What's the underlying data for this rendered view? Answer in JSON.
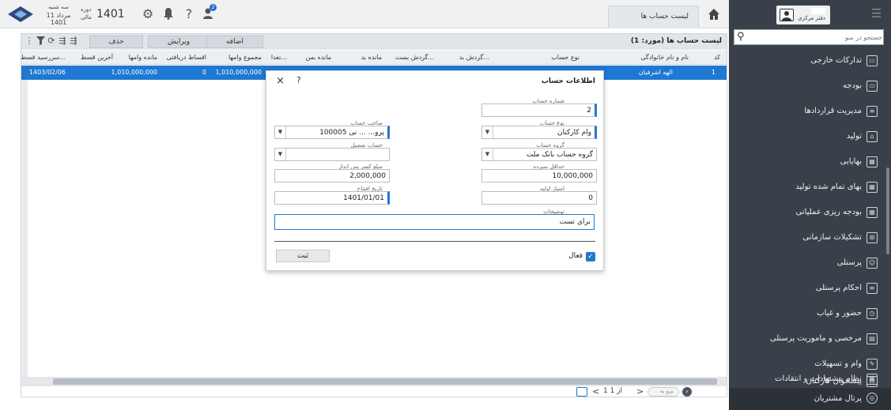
{
  "topbar": {
    "date_line1": "سه شنبه",
    "date_line2": "11 مرداد 1401",
    "period_label": "دوره مالی",
    "period_year": "1401",
    "notification_count": "2",
    "tab_label": "لیست حساب ها"
  },
  "sidebar": {
    "office_label": "دفتر مرکزی",
    "search_placeholder": "جستجو در منو",
    "items": [
      {
        "label": "تدارکات خارجی",
        "icon": "cart-icon"
      },
      {
        "label": "بودجه",
        "icon": "wallet-icon"
      },
      {
        "label": "مدیریت قراردادها",
        "icon": "contract-icon"
      },
      {
        "label": "تولید",
        "icon": "factory-icon"
      },
      {
        "label": "بهایابی",
        "icon": "calculator-icon"
      },
      {
        "label": "بهای تمام شده تولید",
        "icon": "calculator-icon"
      },
      {
        "label": "بودجه ریزی عملیاتی",
        "icon": "calculator-icon"
      },
      {
        "label": "تشکیلات سازمانی",
        "icon": "org-chart-icon"
      },
      {
        "label": "پرسنلی",
        "icon": "person-icon"
      },
      {
        "label": "احکام پرسنلی",
        "icon": "document-icon"
      },
      {
        "label": "حضور و غیاب",
        "icon": "clock-icon"
      },
      {
        "label": "مرخصی و ماموریت پرسنلی",
        "icon": "calendar-icon"
      },
      {
        "label": "وام و تسهیلات",
        "icon": "loan-icon"
      },
      {
        "label": "پیشخوان کارکنان",
        "icon": "desk-icon"
      },
      {
        "label": "نظام پیشنهادات و انتقادات",
        "icon": "suggestion-icon"
      },
      {
        "label": "پرتال مشتریان",
        "icon": "globe-icon"
      }
    ]
  },
  "list": {
    "title": "لیست حساب ها (مورد: 1)",
    "add_label": "اضافه",
    "edit_label": "ویرایش",
    "delete_label": "حذف",
    "columns": [
      "کد",
      "نام و نام خانوادگی",
      "نوع حساب",
      "گردش بد...",
      "گردش بست...",
      "مانده بد",
      "مانده بس",
      "تعدا...",
      "مجموع وامها",
      "اقساط دریافتی",
      "مانده وامها",
      "آخرین قسط",
      "سررسید قسط..."
    ],
    "row": {
      "code": "1",
      "name": "الهه اشرفیان",
      "total_loans": "1,010,000,000",
      "installments_received": "0",
      "loans_balance": "1,010,000,000",
      "due_date": "1403/02/06"
    }
  },
  "pager": {
    "page_info": "1 از 1",
    "goto_placeholder": "برو به"
  },
  "dialog": {
    "title": "اطلاعات حساب",
    "account_number_label": "شماره حساب",
    "account_number": "2",
    "account_type_label": "نوع حساب",
    "account_type": "وام کارکنان",
    "account_owner_label": "صاحب حساب",
    "account_owner": "100005 پرو...  ... نی",
    "account_group_label": "گروه حساب",
    "account_group": "گروه حساب بانک ملت",
    "detail_account_label": "حساب تفصیل",
    "detail_account": "",
    "min_deposit_label": "حداقل سپرده",
    "min_deposit": "10,000,000",
    "savings_deduction_label": "مبلغ کسر پس انداز",
    "savings_deduction": "2,000,000",
    "initial_score_label": "امتیاز اولیه",
    "initial_score": "0",
    "opening_date_label": "تاریخ افتتاح",
    "opening_date": "1401/01/01",
    "description_label": "توضیحات",
    "description": "برای تست",
    "active_label": "فعال",
    "submit_label": "ثبت"
  },
  "colors": {
    "accent": "#1f78d1",
    "sidebar_bg": "#3a4049"
  }
}
